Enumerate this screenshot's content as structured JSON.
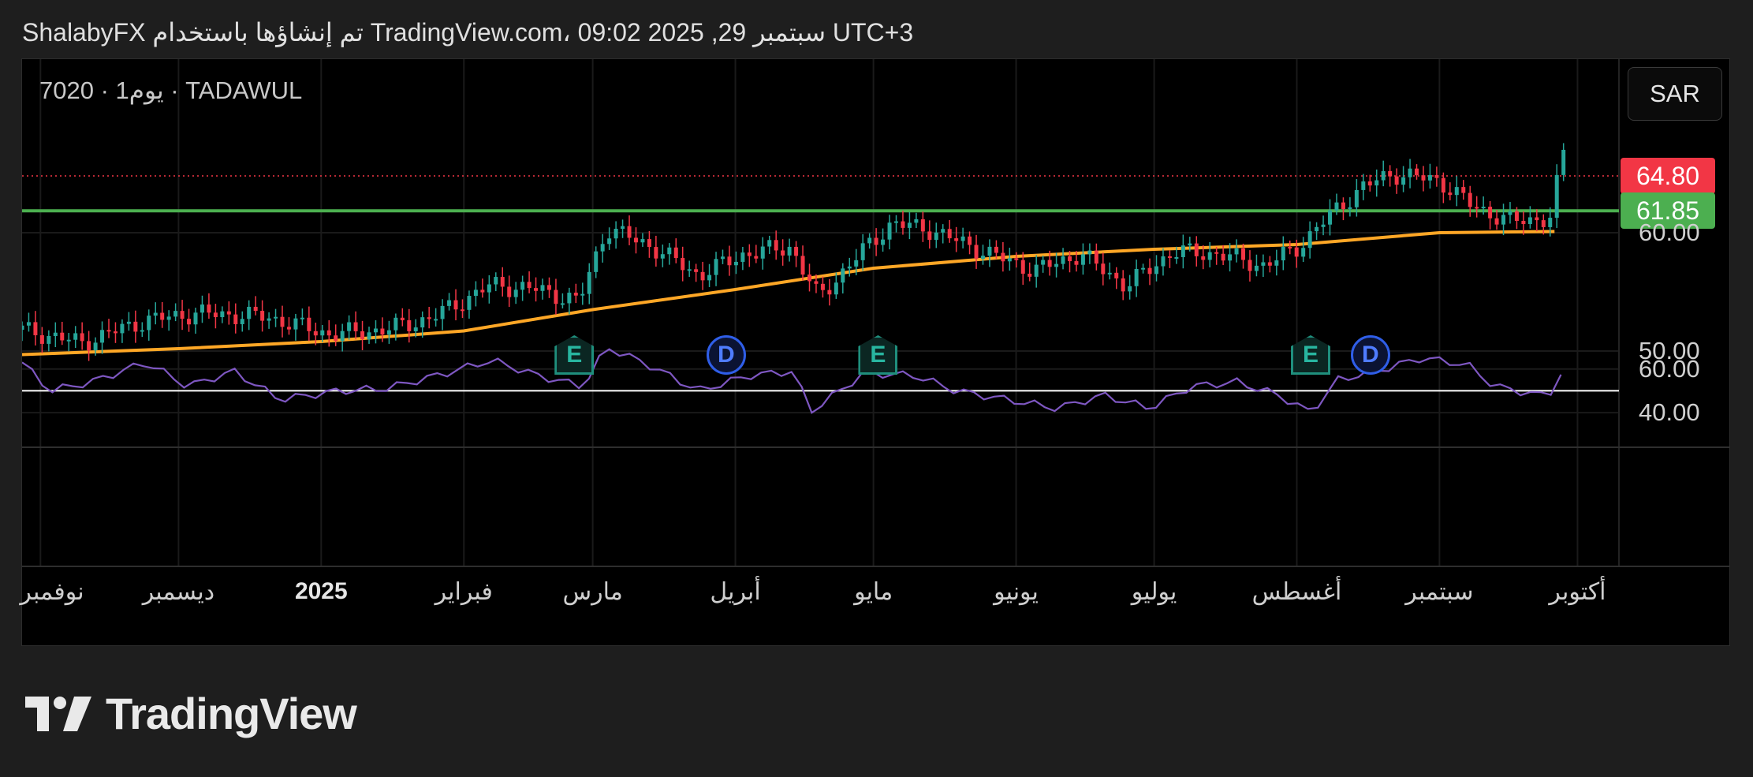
{
  "header": {
    "text": "ShalabyFX تم إنشاؤها باستخدام TradingView.com، 09:02 2025 ,29 سبتمبر UTC+3"
  },
  "chart_header": {
    "symbol_line": "7020 · 1يوم · TADAWUL",
    "currency_button": "SAR"
  },
  "price_tags": {
    "last": "64.80",
    "last_color": "#f23645",
    "level": "61.85",
    "level_color": "#4caf50"
  },
  "brand": {
    "name": "TradingView"
  },
  "icons": {
    "logo": "tradingview-logo-icon",
    "earnings": "earnings-event-icon",
    "dividend": "dividend-event-icon"
  },
  "colors": {
    "up": "#26a69a",
    "down": "#f23645",
    "ma": "#ffa726",
    "rsi": "#7e57c2",
    "level": "#4caf50"
  },
  "chart_data": [
    {
      "type": "candlestick",
      "title": "",
      "price_axis": {
        "ticks": [
          "60.00",
          "50.00"
        ],
        "range_approx": [
          44,
          70
        ]
      },
      "time_axis": {
        "labels": [
          "نوفمبر",
          "ديسمبر",
          "2025",
          "فبراير",
          "مارس",
          "أبريل",
          "مايو",
          "يونيو",
          "يوليو",
          "أغسطس",
          "سبتمبر",
          "أكتوبر"
        ],
        "start": "2024-10-28",
        "end": "2025-10-10"
      },
      "series": [
        {
          "name": "price",
          "approx_closes": [
            {
              "date": "2024-10-28",
              "value": 51.8
            },
            {
              "date": "2024-11-10",
              "value": 50.7
            },
            {
              "date": "2024-11-24",
              "value": 52.6
            },
            {
              "date": "2024-12-05",
              "value": 53.2
            },
            {
              "date": "2024-12-20",
              "value": 52.9
            },
            {
              "date": "2025-01-03",
              "value": 51.4
            },
            {
              "date": "2025-01-15",
              "value": 51.8
            },
            {
              "date": "2025-01-25",
              "value": 52.8
            },
            {
              "date": "2025-02-07",
              "value": 55.6
            },
            {
              "date": "2025-02-17",
              "value": 55.2
            },
            {
              "date": "2025-02-26",
              "value": 54.2
            },
            {
              "date": "2025-03-04",
              "value": 60.4
            },
            {
              "date": "2025-03-14",
              "value": 58.8
            },
            {
              "date": "2025-03-24",
              "value": 56.4
            },
            {
              "date": "2025-04-03",
              "value": 58.2
            },
            {
              "date": "2025-04-13",
              "value": 58.8
            },
            {
              "date": "2025-04-19",
              "value": 54.5
            },
            {
              "date": "2025-04-29",
              "value": 58.6
            },
            {
              "date": "2025-05-05",
              "value": 60.8
            },
            {
              "date": "2025-05-13",
              "value": 60.3
            },
            {
              "date": "2025-05-25",
              "value": 58.4
            },
            {
              "date": "2025-06-05",
              "value": 56.8
            },
            {
              "date": "2025-06-15",
              "value": 58.2
            },
            {
              "date": "2025-06-25",
              "value": 55.5
            },
            {
              "date": "2025-07-05",
              "value": 58.4
            },
            {
              "date": "2025-07-15",
              "value": 58.2
            },
            {
              "date": "2025-07-25",
              "value": 57.2
            },
            {
              "date": "2025-08-01",
              "value": 58.7
            },
            {
              "date": "2025-08-08",
              "value": 61.4
            },
            {
              "date": "2025-08-15",
              "value": 63.8
            },
            {
              "date": "2025-08-22",
              "value": 65.0
            },
            {
              "date": "2025-09-01",
              "value": 64.4
            },
            {
              "date": "2025-09-08",
              "value": 62.3
            },
            {
              "date": "2025-09-16",
              "value": 61.0
            },
            {
              "date": "2025-09-25",
              "value": 61.2
            },
            {
              "date": "2025-09-28",
              "value": 66.8
            },
            {
              "date": "2025-09-29",
              "value": 64.8
            }
          ]
        },
        {
          "name": "moving_average",
          "approx_values": [
            {
              "date": "2024-10-28",
              "value": 49.7
            },
            {
              "date": "2024-12-01",
              "value": 50.2
            },
            {
              "date": "2025-01-01",
              "value": 50.8
            },
            {
              "date": "2025-02-01",
              "value": 51.7
            },
            {
              "date": "2025-03-01",
              "value": 53.5
            },
            {
              "date": "2025-04-01",
              "value": 55.2
            },
            {
              "date": "2025-05-01",
              "value": 57.0
            },
            {
              "date": "2025-06-01",
              "value": 58.0
            },
            {
              "date": "2025-07-01",
              "value": 58.6
            },
            {
              "date": "2025-08-01",
              "value": 59.0
            },
            {
              "date": "2025-09-01",
              "value": 60.0
            },
            {
              "date": "2025-09-26",
              "value": 60.1
            }
          ]
        }
      ],
      "horizontal_lines": [
        {
          "value": 61.85
        }
      ],
      "events": [
        {
          "kind": "E",
          "date": "2025-02-25"
        },
        {
          "kind": "D",
          "date": "2025-03-30"
        },
        {
          "kind": "E",
          "date": "2025-05-02"
        },
        {
          "kind": "E",
          "date": "2025-08-04"
        },
        {
          "kind": "D",
          "date": "2025-08-17"
        }
      ]
    },
    {
      "type": "line",
      "title": "",
      "y_ticks": [
        "60.00",
        "40.00"
      ],
      "ylim": [
        35,
        70
      ],
      "reference_line": 50,
      "series": [
        {
          "name": "rsi",
          "approx_values": [
            {
              "date": "2024-10-28",
              "value": 63
            },
            {
              "date": "2024-11-03",
              "value": 50
            },
            {
              "date": "2024-11-12",
              "value": 54
            },
            {
              "date": "2024-11-24",
              "value": 63
            },
            {
              "date": "2024-12-03",
              "value": 52
            },
            {
              "date": "2024-12-13",
              "value": 59
            },
            {
              "date": "2024-12-23",
              "value": 46
            },
            {
              "date": "2025-01-05",
              "value": 50
            },
            {
              "date": "2025-01-15",
              "value": 51
            },
            {
              "date": "2025-01-28",
              "value": 58
            },
            {
              "date": "2025-02-07",
              "value": 64
            },
            {
              "date": "2025-02-17",
              "value": 57
            },
            {
              "date": "2025-02-27",
              "value": 52
            },
            {
              "date": "2025-03-04",
              "value": 70
            },
            {
              "date": "2025-03-13",
              "value": 62
            },
            {
              "date": "2025-03-24",
              "value": 50
            },
            {
              "date": "2025-04-04",
              "value": 57
            },
            {
              "date": "2025-04-14",
              "value": 59
            },
            {
              "date": "2025-04-17",
              "value": 40
            },
            {
              "date": "2025-04-29",
              "value": 58
            },
            {
              "date": "2025-05-10",
              "value": 57
            },
            {
              "date": "2025-05-19",
              "value": 50
            },
            {
              "date": "2025-05-30",
              "value": 46
            },
            {
              "date": "2025-06-10",
              "value": 42
            },
            {
              "date": "2025-06-20",
              "value": 48
            },
            {
              "date": "2025-06-30",
              "value": 42
            },
            {
              "date": "2025-07-09",
              "value": 52
            },
            {
              "date": "2025-07-19",
              "value": 54
            },
            {
              "date": "2025-07-28",
              "value": 48
            },
            {
              "date": "2025-08-04",
              "value": 40
            },
            {
              "date": "2025-08-10",
              "value": 55
            },
            {
              "date": "2025-08-20",
              "value": 60
            },
            {
              "date": "2025-08-28",
              "value": 65
            },
            {
              "date": "2025-09-07",
              "value": 62
            },
            {
              "date": "2025-09-13",
              "value": 52
            },
            {
              "date": "2025-09-23",
              "value": 48
            },
            {
              "date": "2025-09-27",
              "value": 51
            },
            {
              "date": "2025-09-28",
              "value": 68
            },
            {
              "date": "2025-09-29",
              "value": 56
            }
          ]
        }
      ]
    }
  ]
}
